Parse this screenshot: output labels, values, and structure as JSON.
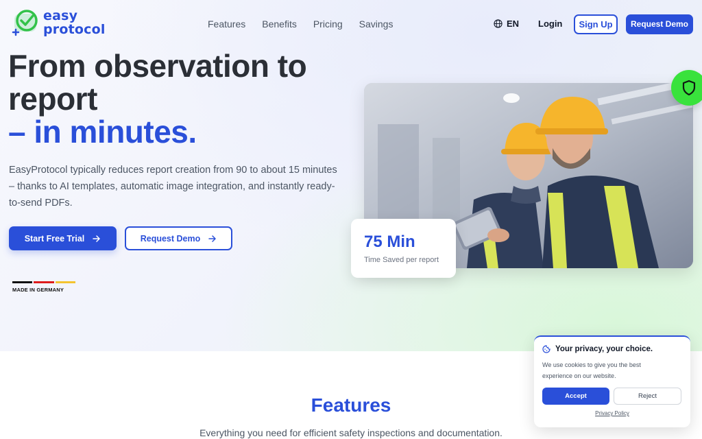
{
  "brand": {
    "line1": "easy",
    "line2": "protocol",
    "color": "#2a4fd9",
    "check_color": "#33c24a"
  },
  "nav": {
    "items": [
      "Features",
      "Benefits",
      "Pricing",
      "Savings"
    ],
    "language": "EN",
    "login": "Login",
    "signup": "Sign Up",
    "request_demo": "Request Demo"
  },
  "hero": {
    "title_line1": "From observation to",
    "title_line2": "report",
    "title_accent": "– in minutes.",
    "lead": "EasyProtocol typically reduces report creation from 90 to about 15 minutes – thanks to AI templates, automatic image integration, and instantly ready-to-send PDFs.",
    "cta_primary": "Start Free Trial",
    "cta_secondary": "Request Demo",
    "made_in": "MADE IN GERMANY",
    "flag_colors": [
      "#111111",
      "#dd1c1c",
      "#f4c430"
    ]
  },
  "stat": {
    "value": "75 Min",
    "label": "Time Saved per report"
  },
  "badge": {
    "color": "#39e23c",
    "icon": "shield-icon"
  },
  "features": {
    "title": "Features",
    "subtitle": "Everything you need for efficient safety inspections and documentation."
  },
  "cookie": {
    "title": "Your privacy, your choice.",
    "text": "We use cookies to give you the best experience on our website.",
    "accept": "Accept",
    "reject": "Reject",
    "policy": "Privacy Policy"
  },
  "colors": {
    "accent": "#2a4fd9",
    "heading": "#2b2f36",
    "success": "#39e23c"
  }
}
